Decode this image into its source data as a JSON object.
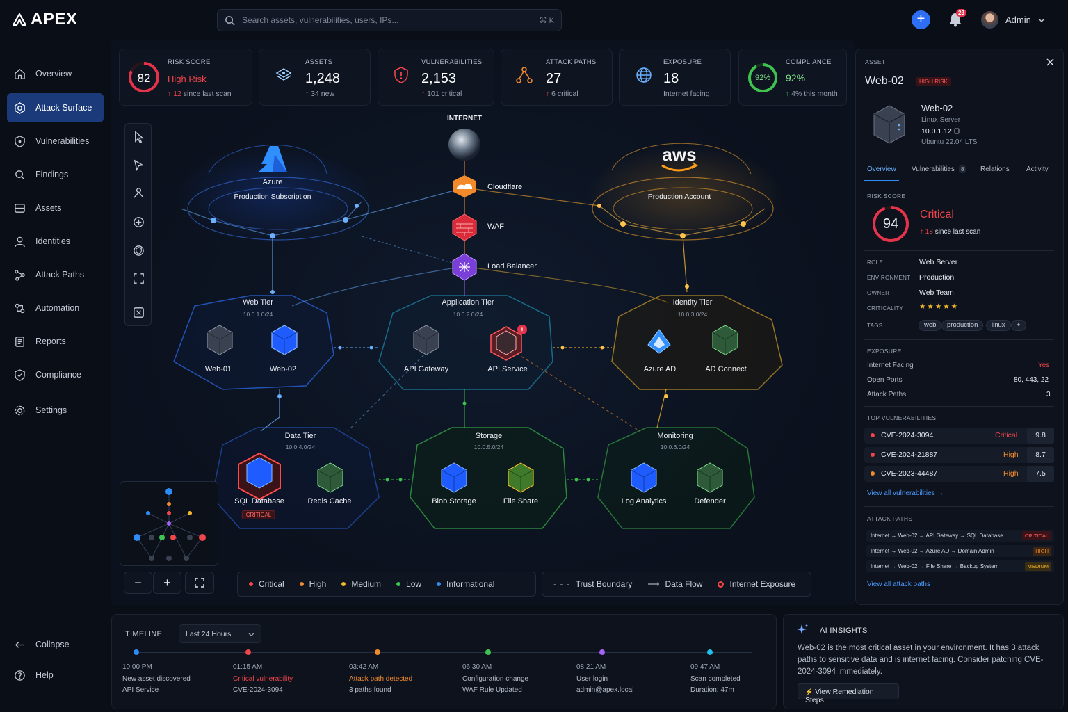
{
  "app": {
    "name": "APEX"
  },
  "search": {
    "placeholder": "Search assets, vulnerabilities, users, IPs...",
    "shortcut": "⌘ K"
  },
  "header": {
    "notifications_count": "23",
    "user_name": "Admin"
  },
  "sidebar": {
    "items": [
      {
        "label": "Overview",
        "icon": "home-icon"
      },
      {
        "label": "Attack Surface",
        "icon": "radar-icon",
        "active": true
      },
      {
        "label": "Vulnerabilities",
        "icon": "shield-icon"
      },
      {
        "label": "Findings",
        "icon": "search-icon"
      },
      {
        "label": "Assets",
        "icon": "server-icon"
      },
      {
        "label": "Identities",
        "icon": "user-icon"
      },
      {
        "label": "Attack Paths",
        "icon": "path-icon"
      },
      {
        "label": "Automation",
        "icon": "automation-icon"
      },
      {
        "label": "Reports",
        "icon": "report-icon"
      },
      {
        "label": "Compliance",
        "icon": "shield-check-icon"
      },
      {
        "label": "Settings",
        "icon": "gear-icon"
      }
    ],
    "collapse_label": "Collapse",
    "help_label": "Help"
  },
  "stats": {
    "risk": {
      "label": "RISK SCORE",
      "value": "82",
      "status": "High Risk",
      "delta": "12",
      "delta_text": "since last scan"
    },
    "assets": {
      "label": "ASSETS",
      "value": "1,248",
      "delta": "34 new"
    },
    "vulnerabilities": {
      "label": "VULNERABILITIES",
      "value": "2,153",
      "delta": "101 critical"
    },
    "attack_paths": {
      "label": "ATTACK PATHS",
      "value": "27",
      "delta": "6 critical"
    },
    "exposure": {
      "label": "EXPOSURE",
      "value": "18",
      "sub": "Internet facing"
    },
    "compliance": {
      "label": "COMPLIANCE",
      "value": "92%",
      "ring": "92%",
      "percent": 92,
      "delta": "4% this month"
    }
  },
  "graph": {
    "internet_label": "INTERNET",
    "cloudflare": "Cloudflare",
    "waf": "WAF",
    "load_balancer": "Load Balancer",
    "azure": {
      "name": "Azure",
      "sub": "Production Subscription"
    },
    "aws": {
      "name": "aws",
      "sub": "Production Account"
    },
    "web_tier": {
      "title": "Web Tier",
      "cidr": "10.0.1.0/24",
      "nodes": [
        "Web-01",
        "Web-02"
      ]
    },
    "app_tier": {
      "title": "Application Tier",
      "cidr": "10.0.2.0/24",
      "nodes": [
        "API Gateway",
        "API Service"
      ]
    },
    "identity_tier": {
      "title": "Identity Tier",
      "cidr": "10.0.3.0/24",
      "nodes": [
        "Azure AD",
        "AD Connect"
      ]
    },
    "data_tier": {
      "title": "Data Tier",
      "cidr": "10.0.4.0/24",
      "nodes": [
        "SQL Database",
        "Redis Cache"
      ],
      "badge": "CRITICAL"
    },
    "storage": {
      "title": "Storage",
      "cidr": "10.0.5.0/24",
      "nodes": [
        "Blob Storage",
        "File Share"
      ]
    },
    "monitoring": {
      "title": "Monitoring",
      "cidr": "10.0.6.0/24",
      "nodes": [
        "Log Analytics",
        "Defender"
      ]
    }
  },
  "legend": {
    "severity": [
      {
        "label": "Critical",
        "color": "#f0454b"
      },
      {
        "label": "High",
        "color": "#f28a2c"
      },
      {
        "label": "Medium",
        "color": "#f2b62c"
      },
      {
        "label": "Low",
        "color": "#3fc24f"
      },
      {
        "label": "Informational",
        "color": "#2d8cf5"
      }
    ],
    "trust_boundary": "Trust Boundary",
    "data_flow": "Data Flow",
    "internet_exposure": "Internet Exposure"
  },
  "panel": {
    "section": "ASSET",
    "name": "Web-02",
    "risk_badge": "HIGH RISK",
    "asset_name": "Web-02",
    "os_type": "Linux Server",
    "ip": "10.0.1.12",
    "os": "Ubuntu 22.04 LTS",
    "tabs": [
      {
        "label": "Overview"
      },
      {
        "label": "Vulnerabilities",
        "count": "8"
      },
      {
        "label": "Relations"
      },
      {
        "label": "Activity"
      }
    ],
    "risk_label": "RISK SCORE",
    "risk_value": "94",
    "risk_status": "Critical",
    "risk_delta": "18",
    "risk_delta_text": "since last scan",
    "props": [
      {
        "k": "ROLE",
        "v": "Web Server"
      },
      {
        "k": "ENVIRONMENT",
        "v": "Production"
      },
      {
        "k": "OWNER",
        "v": "Web Team"
      },
      {
        "k": "CRITICALITY",
        "v": "★★★★★"
      }
    ],
    "tags_label": "TAGS",
    "tags": [
      "web",
      "production",
      "linux",
      "+"
    ],
    "exposure_label": "EXPOSURE",
    "exposure": [
      {
        "k": "Internet Facing",
        "v": "Yes"
      },
      {
        "k": "Open Ports",
        "v": "80, 443, 22"
      },
      {
        "k": "Attack Paths",
        "v": "3"
      }
    ],
    "top_vulns_label": "TOP VULNERABILITIES",
    "vulns": [
      {
        "id": "CVE-2024-3094",
        "sev": "Critical",
        "score": "9.8",
        "color": "#f0454b"
      },
      {
        "id": "CVE-2024-21887",
        "sev": "High",
        "score": "8.7",
        "color": "#f28a2c"
      },
      {
        "id": "CVE-2023-44487",
        "sev": "High",
        "score": "7.5",
        "color": "#f28a2c"
      }
    ],
    "view_all_vulns": "View all vulnerabilities →",
    "attack_paths_label": "ATTACK PATHS",
    "attack_paths": [
      {
        "path": "Internet → Web-02 → API Gateway → SQL Database",
        "sev": "CRITICAL",
        "color": "#f0454b"
      },
      {
        "path": "Internet → Web-02 → Azure AD → Domain Admin",
        "sev": "HIGH",
        "color": "#f28a2c"
      },
      {
        "path": "Internet → Web-02 → File Share → Backup System",
        "sev": "MEDIUM",
        "color": "#f2b62c"
      }
    ],
    "view_all_paths": "View all attack paths →"
  },
  "timeline": {
    "title": "TIMELINE",
    "range": "Last 24 Hours",
    "events": [
      {
        "time": "10:00 PM",
        "title": "New asset discovered",
        "detail": "API Service",
        "color": "#2d8cf5",
        "accent": false
      },
      {
        "time": "01:15 AM",
        "title": "Critical vulnerability",
        "detail": "CVE-2024-3094",
        "color": "#f0454b",
        "accent": true
      },
      {
        "time": "03:42 AM",
        "title": "Attack path detected",
        "detail": "3 paths found",
        "color": "#f28a2c",
        "accent": true
      },
      {
        "time": "06:30 AM",
        "title": "Configuration change",
        "detail": "WAF Rule Updated",
        "color": "#3fc24f",
        "accent": false
      },
      {
        "time": "08:21 AM",
        "title": "User login",
        "detail": "admin@apex.local",
        "color": "#a463f2",
        "accent": false
      },
      {
        "time": "09:47 AM",
        "title": "Scan completed",
        "detail": "Duration: 47m",
        "color": "#22c0e8",
        "accent": false
      }
    ]
  },
  "ai": {
    "title": "AI INSIGHTS",
    "text": "Web-02 is the most critical asset in your environment. It has 3 attack paths to sensitive data and is internet facing. Consider patching CVE-2024-3094 immediately.",
    "button": "View Remediation Steps"
  }
}
